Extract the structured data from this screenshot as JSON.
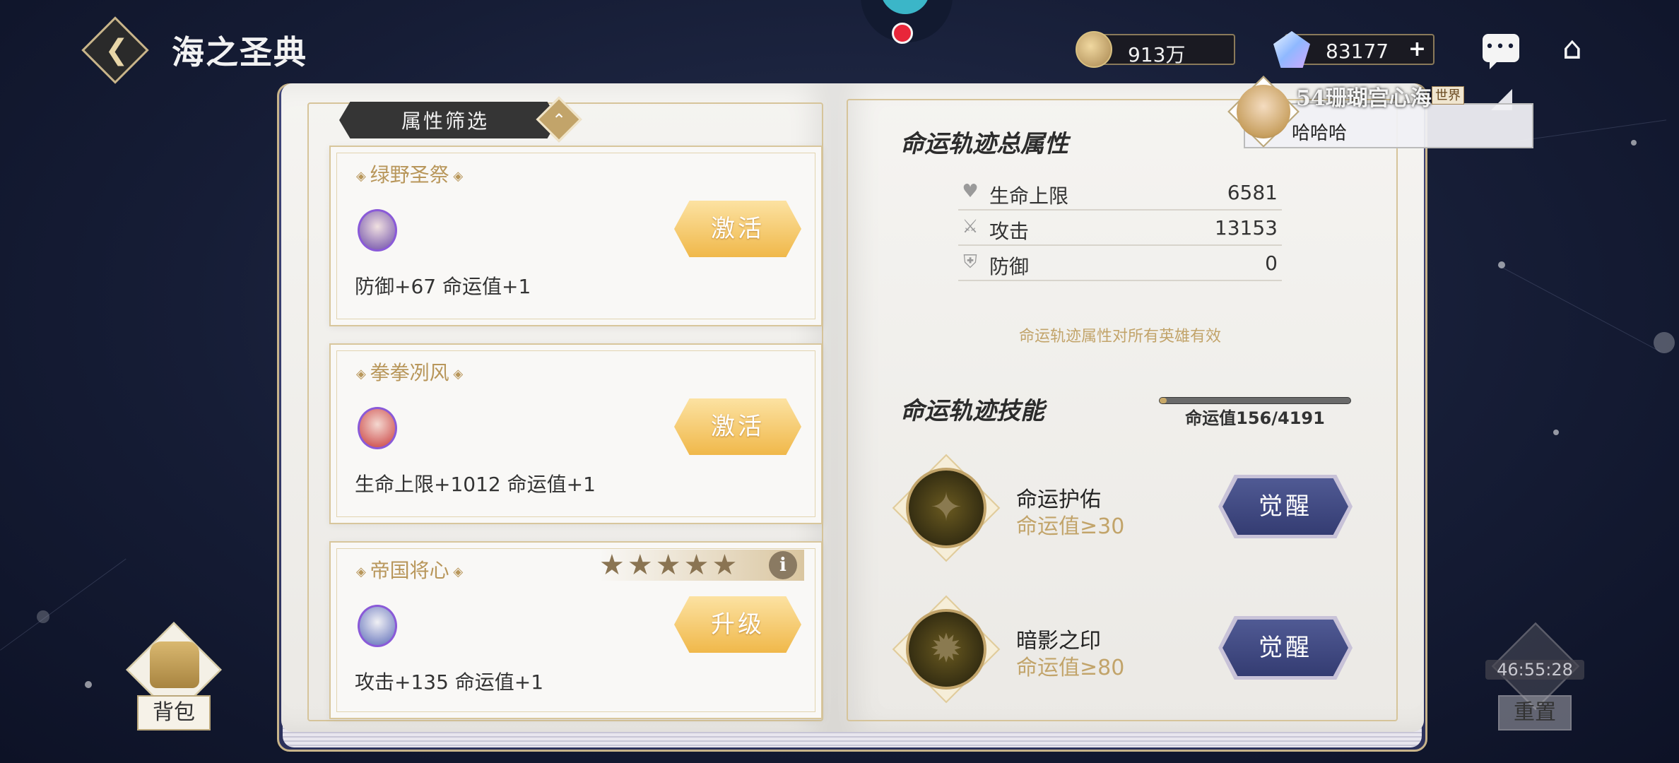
{
  "header": {
    "title": "海之圣典",
    "gold_amount": "913万",
    "gem_amount": "83177",
    "gem_plus": "+"
  },
  "left_page": {
    "filter_label": "属性筛选",
    "cards": [
      {
        "title": "绿野圣祭",
        "desc": "防御+67 命运值+1",
        "button": "激活"
      },
      {
        "title": "拳拳冽风",
        "desc": "生命上限+1012 命运值+1",
        "button": "激活"
      },
      {
        "title": "帝国将心",
        "desc": "攻击+135 命运值+1",
        "button": "升级",
        "stars": "★★★★★",
        "info": "i"
      }
    ]
  },
  "right_page": {
    "total_title": "命运轨迹总属性",
    "stats": [
      {
        "label": "生命上限",
        "value": "6581",
        "icon": "heart-icon"
      },
      {
        "label": "攻击",
        "value": "13153",
        "icon": "sword-icon"
      },
      {
        "label": "防御",
        "value": "0",
        "icon": "shield-icon"
      }
    ],
    "note": "命运轨迹属性对所有英雄有效",
    "skill_title": "命运轨迹技能",
    "progress_text": "命运值156/4191",
    "progress_fraction": 0.037,
    "skills": [
      {
        "name": "命运护佑",
        "requirement": "命运值≥30",
        "button": "觉醒"
      },
      {
        "name": "暗影之印",
        "requirement": "命运值≥80",
        "button": "觉醒"
      }
    ]
  },
  "chat": {
    "user": "54珊瑚宫心海",
    "tag": "世界",
    "message": "哈哈哈"
  },
  "bottom": {
    "bag_label": "背包",
    "reset_timer": "46:55:28",
    "reset_label": "重置"
  },
  "colors": {
    "background": "#161d36",
    "gold_accent": "#c2a46a",
    "activate_button": "#f0b84a",
    "awaken_button": "#343c72"
  }
}
